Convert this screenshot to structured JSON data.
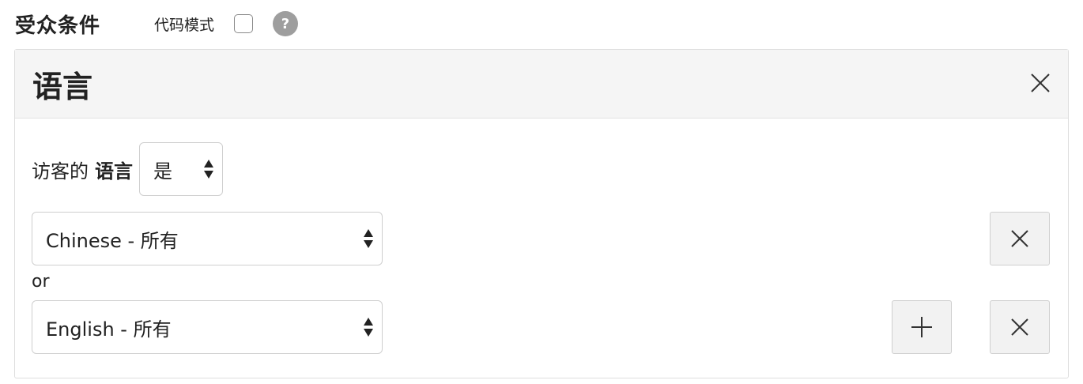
{
  "header": {
    "section_title": "受众条件",
    "code_mode_label": "代码模式",
    "code_mode_checked": false,
    "help_icon_glyph": "?"
  },
  "panel": {
    "title": "语言",
    "rule": {
      "prefix": "访客的",
      "field": "语言",
      "operator": "是"
    },
    "conditions": [
      {
        "value": "Chinese - 所有"
      },
      {
        "value": "English - 所有"
      }
    ],
    "or_label": "or"
  },
  "colors": {
    "panel_header_bg": "#f5f5f5",
    "button_bg": "#f2f2f2",
    "help_icon_bg": "#9e9e9e",
    "border": "#cfcfcf"
  }
}
